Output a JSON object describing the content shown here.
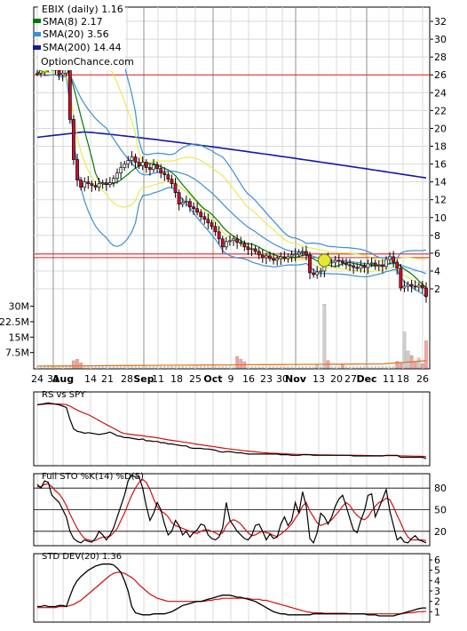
{
  "colors": {
    "background": "#ffffff",
    "frame": "#000000",
    "grid": "#d8d8d8",
    "sma8": "#007a00",
    "sma20": "#3a8fd6",
    "sma200": "#1616a8",
    "bollinger_env": "#e8e832",
    "up_candle": "#e6e6e6",
    "down_candle": "#c8102e",
    "ref_line": "#e02020",
    "volume_up": "#cfcfcf",
    "volume_down": "#e8a8a8",
    "volume_avg": "#e07820",
    "rs_line": "#000000",
    "rs_avg": "#d01010",
    "k_line": "#000000",
    "d_line": "#d01010",
    "std_line": "#000000",
    "std_avg": "#d01010"
  },
  "chart_data": [
    {
      "type": "candlestick",
      "title": "EBIX (daily) 1.16",
      "legend": [
        {
          "label": "SMA(8) 2.17",
          "color": "#007a00"
        },
        {
          "label": "SMA(20) 3.56",
          "color": "#3a8fd6"
        },
        {
          "label": "SMA(200) 14.44",
          "color": "#1616a8"
        }
      ],
      "watermark": "OptionChance.com",
      "y_ticks": [
        2,
        4,
        6,
        8,
        10,
        12,
        14,
        16,
        18,
        20,
        22,
        24,
        26,
        28,
        30,
        32
      ],
      "ylim": [
        0,
        33
      ],
      "x_ticks": [
        "24",
        "31",
        "Aug",
        "14",
        "21",
        "28",
        "Sep",
        "11",
        "18",
        "25",
        "Oct",
        "9",
        "16",
        "23",
        "30",
        "Nov",
        "13",
        "20",
        "27",
        "Dec",
        "11",
        "18",
        "26"
      ],
      "reference_lines": [
        26,
        5.9,
        5.5
      ],
      "close": [
        26.2,
        26.5,
        27,
        27.2,
        26.8,
        26.5,
        26,
        26.2,
        26.8,
        21,
        16.5,
        14.2,
        13.4,
        14,
        13.8,
        13.6,
        13.4,
        13.8,
        13.9,
        13.7,
        13.9,
        14.4,
        15,
        15.6,
        16,
        16.4,
        16.8,
        16.2,
        15.8,
        16.2,
        15.6,
        15.4,
        15.9,
        15.5,
        15,
        14.8,
        14.3,
        13.8,
        12.8,
        11.5,
        11.7,
        11.8,
        11.2,
        11,
        10.6,
        10.1,
        9.8,
        9.4,
        9,
        8.4,
        7.6,
        6.7,
        7.3,
        7.4,
        7.6,
        7.2,
        7.1,
        6.7,
        6.4,
        6.5,
        6.2,
        5.8,
        5.5,
        5.7,
        5.4,
        5.2,
        5.4,
        5.6,
        5.4,
        5.6,
        5.8,
        5.9,
        6.1,
        6.2,
        5.8,
        3.8,
        3.6,
        3.9,
        4,
        5.4,
        4.9,
        5,
        5.2,
        5.1,
        4.9,
        4.7,
        4.6,
        4.4,
        4.3,
        4.6,
        4.4,
        4.8,
        4.9,
        4.6,
        4.7,
        4.5,
        5.3,
        5.6,
        5,
        4.3,
        2.1,
        2.3,
        2.5,
        2.3,
        2.2,
        2.4,
        2.1,
        1.16
      ],
      "sma8_last": 2.17,
      "sma20_last": 3.56,
      "sma200_start": 19,
      "sma200_peak": 19.6,
      "sma200_last": 14.44
    },
    {
      "type": "bar",
      "title": "Volume",
      "y_ticks": [
        "7.5M",
        "15M",
        "22.5M",
        "30M"
      ],
      "y_tick_values": [
        7.5,
        15,
        22.5,
        30
      ],
      "ylim": [
        0,
        32
      ],
      "spikes": [
        {
          "day": 10,
          "value": 3.5
        },
        {
          "day": 11,
          "value": 4.2
        },
        {
          "day": 12,
          "value": 2.5
        },
        {
          "day": 55,
          "value": 5.6
        },
        {
          "day": 56,
          "value": 4.2
        },
        {
          "day": 57,
          "value": 3.0
        },
        {
          "day": 77,
          "value": 1.8
        },
        {
          "day": 79,
          "value": 31.0
        },
        {
          "day": 80,
          "value": 3.6
        },
        {
          "day": 84,
          "value": 2.0
        },
        {
          "day": 99,
          "value": 3.2
        },
        {
          "day": 100,
          "value": 2.2
        },
        {
          "day": 101,
          "value": 17.5
        },
        {
          "day": 102,
          "value": 8.2
        },
        {
          "day": 103,
          "value": 6.0
        },
        {
          "day": 104,
          "value": 3.0
        },
        {
          "day": 105,
          "value": 4.8
        },
        {
          "day": 106,
          "value": 2.0
        },
        {
          "day": 107,
          "value": 13.2
        }
      ]
    },
    {
      "type": "line",
      "title": "RS vs SPY",
      "series": [
        {
          "name": "RS vs SPY",
          "values": [
            0.88,
            0.89,
            0.9,
            0.91,
            0.9,
            0.89,
            0.88,
            0.86,
            0.84,
            0.65,
            0.5,
            0.46,
            0.45,
            0.43,
            0.44,
            0.43,
            0.42,
            0.41,
            0.42,
            0.43,
            0.45,
            0.42,
            0.39,
            0.38,
            0.36,
            0.36,
            0.35,
            0.34,
            0.33,
            0.34,
            0.31,
            0.31,
            0.3,
            0.3,
            0.28,
            0.28,
            0.26,
            0.26,
            0.25,
            0.24,
            0.23,
            0.23,
            0.2,
            0.19,
            0.19,
            0.19,
            0.18,
            0.18,
            0.17,
            0.16,
            0.14,
            0.13,
            0.14,
            0.14,
            0.13,
            0.12,
            0.12,
            0.11,
            0.1,
            0.1,
            0.1,
            0.1,
            0.1,
            0.1,
            0.1,
            0.1,
            0.1,
            0.09,
            0.09,
            0.09,
            0.08,
            0.08,
            0.08,
            0.09,
            0.09,
            0.09,
            0.08,
            0.08,
            0.08,
            0.08,
            0.08,
            0.08,
            0.08,
            0.08,
            0.08,
            0.08,
            0.08,
            0.07,
            0.07,
            0.07,
            0.07,
            0.07,
            0.07,
            0.07,
            0.07,
            0.07,
            0.08,
            0.08,
            0.08,
            0.08,
            0.05,
            0.05,
            0.05,
            0.05,
            0.05,
            0.05,
            0.05,
            0.03
          ]
        }
      ]
    },
    {
      "type": "line",
      "title": "Full STO %K(14) %D(5)",
      "y_ticks": [
        20,
        50,
        80
      ],
      "ylim": [
        0,
        100
      ],
      "series": [
        {
          "name": "%K(14)",
          "values": [
            85,
            80,
            90,
            88,
            70,
            65,
            60,
            50,
            40,
            20,
            10,
            6,
            4,
            8,
            6,
            5,
            10,
            20,
            15,
            8,
            15,
            25,
            40,
            55,
            70,
            90,
            98,
            95,
            96,
            80,
            55,
            35,
            45,
            60,
            50,
            30,
            15,
            20,
            35,
            28,
            15,
            20,
            12,
            18,
            22,
            30,
            28,
            15,
            10,
            8,
            12,
            25,
            60,
            35,
            28,
            20,
            15,
            10,
            8,
            14,
            28,
            30,
            20,
            8,
            16,
            10,
            12,
            30,
            40,
            28,
            35,
            60,
            45,
            75,
            55,
            10,
            4,
            18,
            45,
            40,
            30,
            40,
            55,
            65,
            70,
            55,
            38,
            22,
            18,
            35,
            48,
            70,
            72,
            40,
            52,
            65,
            78,
            48,
            28,
            8,
            12,
            5,
            4,
            10,
            14,
            8,
            6,
            4
          ]
        },
        {
          "name": "%D(5)",
          "values": [
            82,
            82,
            85,
            86,
            82,
            76,
            72,
            65,
            56,
            44,
            34,
            24,
            16,
            10,
            8,
            7,
            7,
            10,
            12,
            12,
            13,
            18,
            24,
            35,
            45,
            58,
            70,
            80,
            88,
            92,
            88,
            78,
            65,
            54,
            48,
            45,
            40,
            32,
            28,
            26,
            24,
            22,
            20,
            18,
            17,
            20,
            22,
            22,
            20,
            18,
            15,
            18,
            28,
            34,
            36,
            34,
            30,
            24,
            18,
            14,
            15,
            18,
            20,
            18,
            17,
            14,
            13,
            16,
            20,
            25,
            30,
            38,
            45,
            55,
            60,
            48,
            40,
            32,
            28,
            30,
            32,
            36,
            42,
            48,
            55,
            60,
            56,
            48,
            42,
            38,
            36,
            40,
            48,
            55,
            60,
            62,
            66,
            64,
            54,
            42,
            32,
            20,
            12,
            8,
            8,
            8,
            8,
            7
          ]
        }
      ]
    },
    {
      "type": "line",
      "title": "STD DEV(20) 1.36",
      "y_ticks": [
        1,
        2,
        3,
        4,
        5,
        6
      ],
      "ylim": [
        0,
        6.6
      ],
      "series": [
        {
          "name": "STD DEV(20)",
          "values": [
            1.5,
            1.5,
            1.6,
            1.5,
            1.5,
            1.5,
            1.6,
            1.6,
            1.5,
            2.5,
            3.4,
            4.0,
            4.4,
            4.7,
            5.0,
            5.2,
            5.4,
            5.5,
            5.6,
            5.6,
            5.6,
            5.5,
            5.2,
            4.8,
            4.0,
            3.0,
            1.5,
            0.9,
            0.8,
            0.7,
            0.7,
            0.7,
            0.8,
            0.8,
            0.8,
            0.8,
            0.9,
            1.0,
            1.2,
            1.4,
            1.6,
            1.7,
            1.8,
            1.9,
            2.0,
            2.0,
            2.1,
            2.2,
            2.3,
            2.4,
            2.5,
            2.6,
            2.6,
            2.6,
            2.5,
            2.4,
            2.4,
            2.3,
            2.2,
            2.1,
            2.0,
            1.8,
            1.6,
            1.4,
            1.2,
            1.0,
            0.9,
            0.8,
            0.8,
            0.7,
            0.7,
            0.7,
            0.7,
            0.7,
            0.7,
            0.7,
            0.8,
            0.8,
            0.8,
            0.8,
            0.8,
            0.8,
            0.8,
            0.8,
            0.8,
            0.8,
            0.8,
            0.8,
            0.8,
            0.8,
            0.8,
            0.7,
            0.7,
            0.7,
            0.6,
            0.6,
            0.6,
            0.6,
            0.6,
            0.7,
            0.8,
            0.9,
            1.0,
            1.1,
            1.2,
            1.3,
            1.36,
            1.36
          ]
        },
        {
          "name": "Average",
          "values": [
            1.4,
            1.4,
            1.4,
            1.4,
            1.4,
            1.4,
            1.5,
            1.5,
            1.5,
            1.6,
            1.7,
            1.9,
            2.1,
            2.4,
            2.7,
            3.0,
            3.3,
            3.6,
            3.9,
            4.2,
            4.5,
            4.7,
            4.8,
            4.8,
            4.7,
            4.5,
            4.3,
            4.0,
            3.6,
            3.3,
            3.0,
            2.7,
            2.5,
            2.3,
            2.2,
            2.1,
            2.0,
            2.0,
            2.0,
            2.0,
            2.0,
            2.0,
            2.0,
            2.0,
            2.0,
            2.0,
            2.0,
            2.1,
            2.1,
            2.2,
            2.2,
            2.3,
            2.3,
            2.3,
            2.3,
            2.3,
            2.3,
            2.3,
            2.3,
            2.2,
            2.2,
            2.2,
            2.1,
            2.1,
            2.0,
            1.9,
            1.8,
            1.7,
            1.6,
            1.5,
            1.4,
            1.3,
            1.2,
            1.1,
            1.0,
            0.95,
            0.9,
            0.9,
            0.9,
            0.85,
            0.85,
            0.85,
            0.85,
            0.85,
            0.85,
            0.85,
            0.8,
            0.8,
            0.8,
            0.8,
            0.8,
            0.8,
            0.8,
            0.8,
            0.8,
            0.8,
            0.8,
            0.8,
            0.8,
            0.8,
            0.8,
            0.85,
            0.9,
            0.9,
            0.95,
            1.0,
            1.0,
            1.05
          ]
        }
      ]
    }
  ]
}
